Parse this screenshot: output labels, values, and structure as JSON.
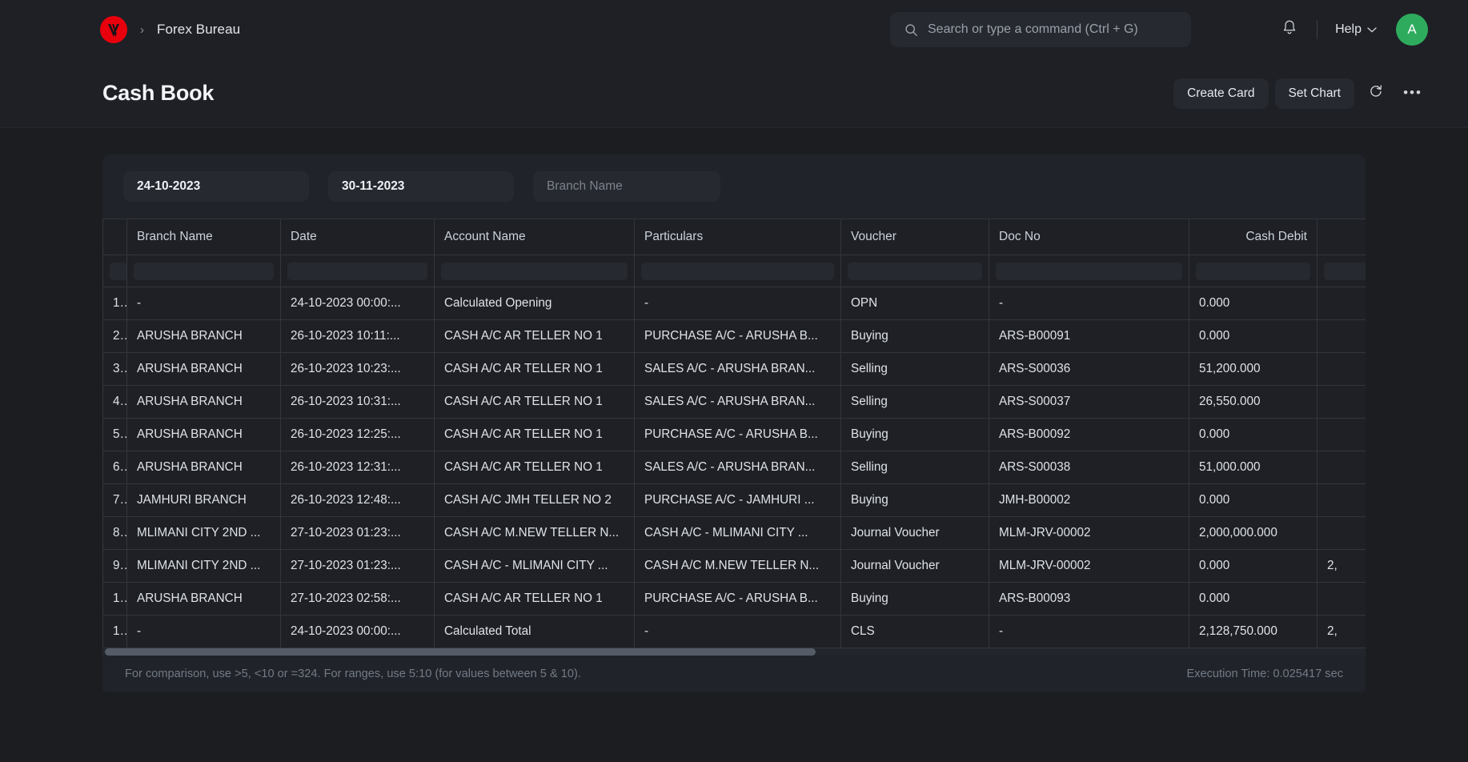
{
  "navbar": {
    "logo_icon": "vasta-logo-icon",
    "breadcrumb_separator": "›",
    "breadcrumb_label": "Forex Bureau",
    "search": {
      "icon": "search-icon",
      "placeholder": "Search or type a command (Ctrl + G)"
    },
    "notification_icon": "bell-icon",
    "help_label": "Help",
    "help_chevron_icon": "chevron-down-icon",
    "avatar_initial": "A",
    "avatar_color": "#2eab5d",
    "logo_color": "#e8000d"
  },
  "page": {
    "title": "Cash Book",
    "actions": {
      "create_card": "Create Card",
      "set_chart": "Set Chart",
      "refresh_icon": "refresh-icon",
      "more_icon": "ellipsis-icon"
    }
  },
  "filters": {
    "from_date": "24-10-2023",
    "to_date": "30-11-2023",
    "branch_placeholder": "Branch Name"
  },
  "table": {
    "columns": [
      {
        "key": "idx",
        "label": "",
        "align": "left"
      },
      {
        "key": "branch",
        "label": "Branch Name",
        "align": "left"
      },
      {
        "key": "date",
        "label": "Date",
        "align": "left"
      },
      {
        "key": "account",
        "label": "Account Name",
        "align": "left"
      },
      {
        "key": "particulars",
        "label": "Particulars",
        "align": "left"
      },
      {
        "key": "voucher",
        "label": "Voucher",
        "align": "left"
      },
      {
        "key": "docno",
        "label": "Doc No",
        "align": "left"
      },
      {
        "key": "debit",
        "label": "Cash Debit",
        "align": "right"
      },
      {
        "key": "credit",
        "label": "",
        "align": "right"
      },
      {
        "key": "balance",
        "label": "",
        "align": "right"
      }
    ],
    "rows": [
      {
        "idx": "1",
        "branch": "-",
        "date": "24-10-2023 00:00:...",
        "account": "Calculated Opening",
        "particulars": "-",
        "voucher": "OPN",
        "docno": "-",
        "debit": "0.000",
        "credit": "",
        "balance": ""
      },
      {
        "idx": "2",
        "branch": "ARUSHA BRANCH",
        "date": "26-10-2023 10:11:...",
        "account": "CASH A/C AR TELLER NO 1",
        "particulars": "PURCHASE A/C - ARUSHA B...",
        "voucher": "Buying",
        "docno": "ARS-B00091",
        "debit": "0.000",
        "credit": "",
        "balance": ""
      },
      {
        "idx": "3",
        "branch": "ARUSHA BRANCH",
        "date": "26-10-2023 10:23:...",
        "account": "CASH A/C AR TELLER NO 1",
        "particulars": "SALES A/C - ARUSHA BRAN...",
        "voucher": "Selling",
        "docno": "ARS-S00036",
        "debit": "51,200.000",
        "credit": "",
        "balance": ""
      },
      {
        "idx": "4",
        "branch": "ARUSHA BRANCH",
        "date": "26-10-2023 10:31:...",
        "account": "CASH A/C AR TELLER NO 1",
        "particulars": "SALES A/C - ARUSHA BRAN...",
        "voucher": "Selling",
        "docno": "ARS-S00037",
        "debit": "26,550.000",
        "credit": "",
        "balance": ""
      },
      {
        "idx": "5",
        "branch": "ARUSHA BRANCH",
        "date": "26-10-2023 12:25:...",
        "account": "CASH A/C AR TELLER NO 1",
        "particulars": "PURCHASE A/C - ARUSHA B...",
        "voucher": "Buying",
        "docno": "ARS-B00092",
        "debit": "0.000",
        "credit": "",
        "balance": ""
      },
      {
        "idx": "6",
        "branch": "ARUSHA BRANCH",
        "date": "26-10-2023 12:31:...",
        "account": "CASH A/C AR TELLER NO 1",
        "particulars": "SALES A/C - ARUSHA BRAN...",
        "voucher": "Selling",
        "docno": "ARS-S00038",
        "debit": "51,000.000",
        "credit": "",
        "balance": ""
      },
      {
        "idx": "7",
        "branch": "JAMHURI BRANCH",
        "date": "26-10-2023 12:48:...",
        "account": "CASH A/C JMH TELLER NO 2",
        "particulars": "PURCHASE A/C - JAMHURI ...",
        "voucher": "Buying",
        "docno": "JMH-B00002",
        "debit": "0.000",
        "credit": "",
        "balance": ""
      },
      {
        "idx": "8",
        "branch": "MLIMANI CITY 2ND ...",
        "date": "27-10-2023 01:23:...",
        "account": "CASH A/C M.NEW TELLER N...",
        "particulars": "CASH A/C - MLIMANI CITY ...",
        "voucher": "Journal Voucher",
        "docno": "MLM-JRV-00002",
        "debit": "2,000,000.000",
        "credit": "",
        "balance": ""
      },
      {
        "idx": "9",
        "branch": "MLIMANI CITY 2ND ...",
        "date": "27-10-2023 01:23:...",
        "account": "CASH A/C - MLIMANI CITY ...",
        "particulars": "CASH A/C M.NEW TELLER N...",
        "voucher": "Journal Voucher",
        "docno": "MLM-JRV-00002",
        "debit": "0.000",
        "credit": "2,",
        "balance": ""
      },
      {
        "idx": "1...",
        "branch": "ARUSHA BRANCH",
        "date": "27-10-2023 02:58:...",
        "account": "CASH A/C AR TELLER NO 1",
        "particulars": "PURCHASE A/C - ARUSHA B...",
        "voucher": "Buying",
        "docno": "ARS-B00093",
        "debit": "0.000",
        "credit": "",
        "balance": ""
      },
      {
        "idx": "1...",
        "branch": "-",
        "date": "24-10-2023 00:00:...",
        "account": "Calculated Total",
        "particulars": "-",
        "voucher": "CLS",
        "docno": "-",
        "debit": "2,128,750.000",
        "credit": "2,",
        "balance": ""
      }
    ]
  },
  "footer": {
    "hint": "For comparison, use >5, <10 or =324. For ranges, use 5:10 (for values between 5 & 10).",
    "execution_time": "Execution Time: 0.025417 sec"
  }
}
